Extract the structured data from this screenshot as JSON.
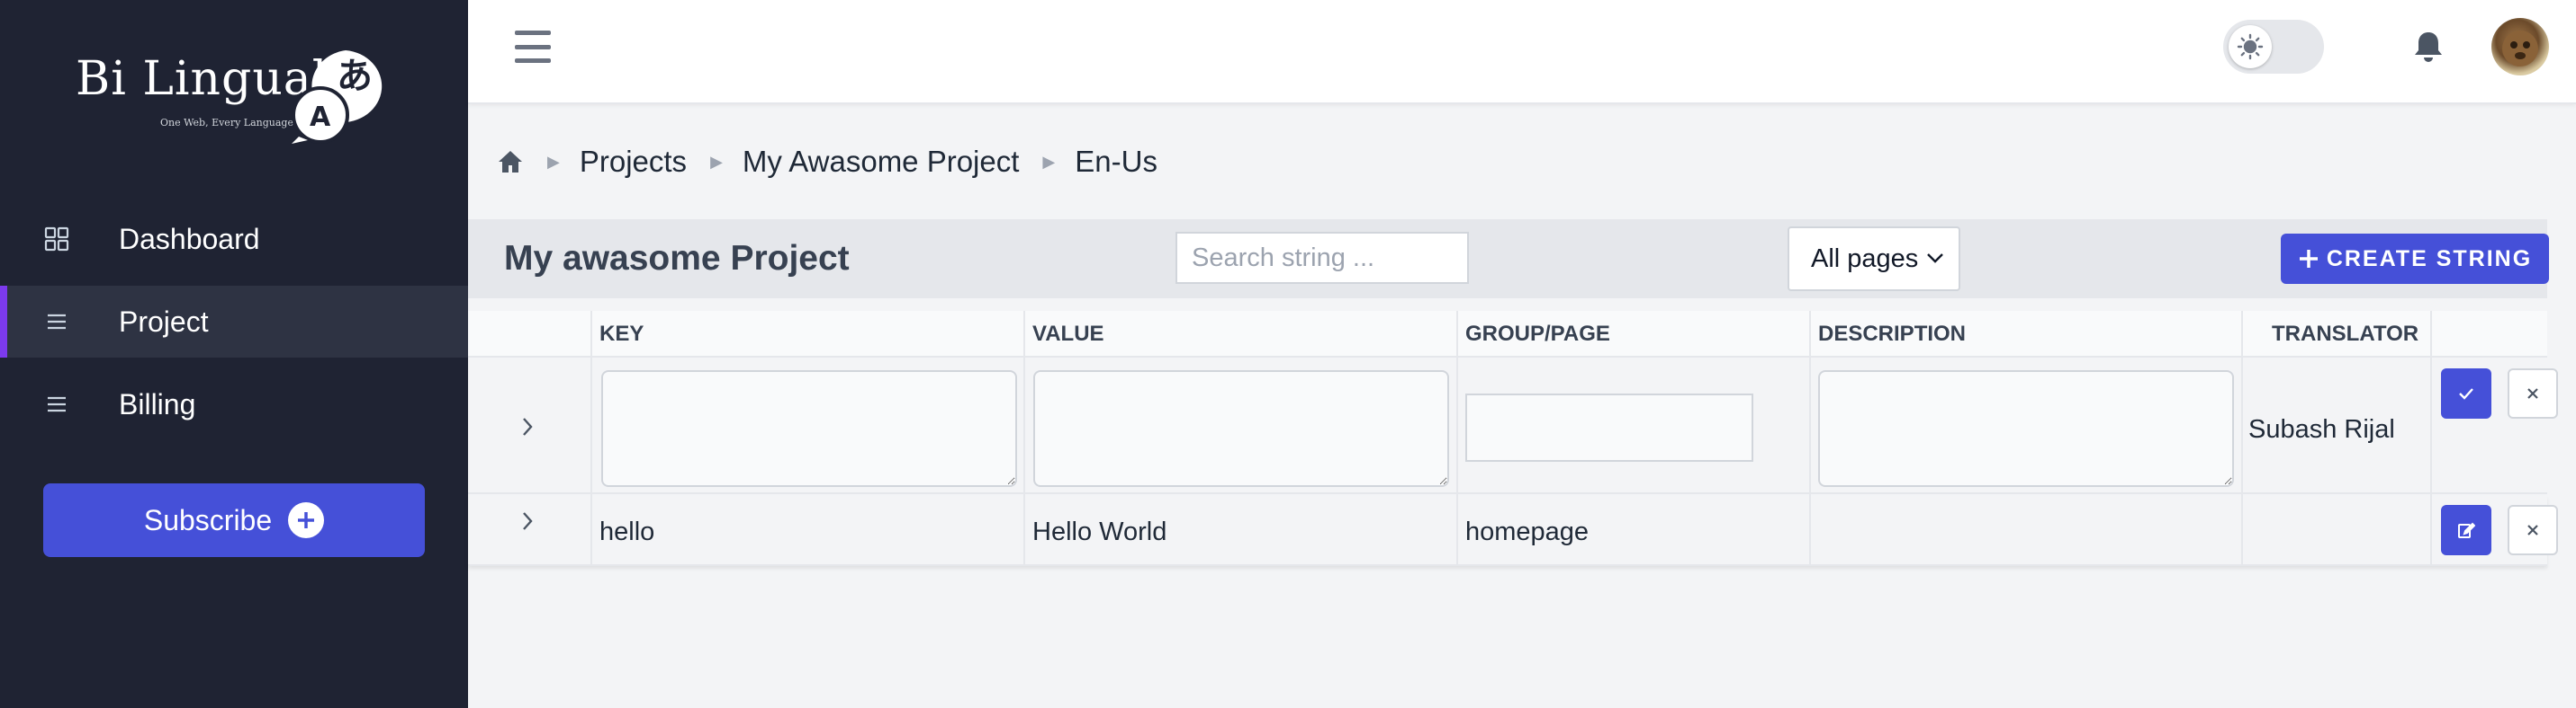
{
  "app": {
    "logo_text": "Bi Lingual",
    "logo_tagline": "One Web, Every Language",
    "logo_glyph_a": "A",
    "logo_glyph_jp": "あ"
  },
  "sidebar": {
    "items": [
      {
        "label": "Dashboard",
        "icon": "grid-icon",
        "active": false
      },
      {
        "label": "Project",
        "icon": "list-icon",
        "active": true
      },
      {
        "label": "Billing",
        "icon": "list-icon",
        "active": false
      }
    ],
    "subscribe_label": "Subscribe"
  },
  "topbar": {
    "theme_toggle": "light",
    "icons": [
      "menu-icon",
      "sun-icon",
      "bell-icon",
      "avatar"
    ]
  },
  "breadcrumb": {
    "items": [
      "Projects",
      "My Awasome Project",
      "En-Us"
    ]
  },
  "header": {
    "title": "My awasome Project",
    "search_placeholder": "Search string ...",
    "filter_selected": "All pages",
    "create_label": "CREATE STRING"
  },
  "table": {
    "columns": [
      "KEY",
      "VALUE",
      "GROUP/PAGE",
      "DESCRIPTION",
      "TRANSLATOR"
    ],
    "new_row": {
      "translator": "Subash Rijal"
    },
    "rows": [
      {
        "key": "hello",
        "value": "Hello World",
        "group": "homepage",
        "description": "",
        "translator": ""
      }
    ]
  },
  "colors": {
    "sidebar_bg": "#1f2333",
    "accent": "#4550d8",
    "active_indicator": "#7c3aed"
  }
}
